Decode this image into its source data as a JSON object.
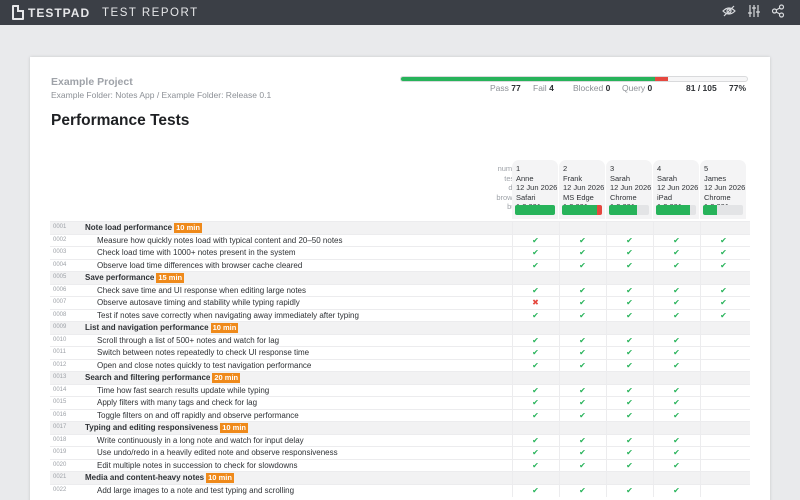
{
  "topbar": {
    "brand": "TESTPAD",
    "title": "TEST REPORT",
    "icons": [
      "eye-off-icon",
      "sliders-icon",
      "share-icon"
    ]
  },
  "report": {
    "project": "Example Project",
    "breadcrumb": "Example Folder: Notes App / Example Folder: Release 0.1",
    "title": "Performance Tests"
  },
  "summary": {
    "pass_label": "Pass",
    "pass": "77",
    "fail_label": "Fail",
    "fail": "4",
    "blocked_label": "Blocked",
    "blocked": "0",
    "query_label": "Query",
    "query": "0",
    "progress": "81 / 105",
    "percent": "77%",
    "bar": {
      "pass": 0.733,
      "fail": 0.038
    }
  },
  "header_labels": [
    "number",
    "tester",
    "date",
    "browser",
    "build"
  ],
  "columns": [
    {
      "number": "1",
      "tester": "Anne",
      "date": "12 Jun 2026",
      "browser": "Safari",
      "build": "1.2.001",
      "pass": 1.0,
      "fail": 0.0
    },
    {
      "number": "2",
      "tester": "Frank",
      "date": "12 Jun 2026",
      "browser": "MS Edge",
      "build": "1.2.001",
      "pass": 0.87,
      "fail": 0.13
    },
    {
      "number": "3",
      "tester": "Sarah",
      "date": "12 Jun 2026",
      "browser": "Chrome",
      "build": "1.2.001",
      "pass": 0.7,
      "fail": 0.0
    },
    {
      "number": "4",
      "tester": "Sarah",
      "date": "12 Jun 2026",
      "browser": "iPad",
      "build": "1.2.001",
      "pass": 0.85,
      "fail": 0.0
    },
    {
      "number": "5",
      "tester": "James",
      "date": "12 Jun 2026",
      "browser": "Chrome",
      "build": "1.2.001",
      "pass": 0.35,
      "fail": 0.0
    }
  ],
  "rows": [
    {
      "id": "0001",
      "kind": "section",
      "text": "Note load performance",
      "time": "10 min",
      "results": []
    },
    {
      "id": "0002",
      "kind": "test",
      "text": "Measure how quickly notes load with typical content and 20–50 notes",
      "results": [
        "p",
        "p",
        "p",
        "p",
        "p"
      ]
    },
    {
      "id": "0003",
      "kind": "test",
      "text": "Check load time with 1000+ notes present in the system",
      "results": [
        "p",
        "p",
        "p",
        "p",
        "p"
      ]
    },
    {
      "id": "0004",
      "kind": "test",
      "text": "Observe load time differences with browser cache cleared",
      "results": [
        "p",
        "p",
        "p",
        "p",
        "p"
      ]
    },
    {
      "id": "0005",
      "kind": "section",
      "text": "Save performance",
      "time": "15 min",
      "results": []
    },
    {
      "id": "0006",
      "kind": "test",
      "text": "Check save time and UI response when editing large notes",
      "results": [
        "p",
        "p",
        "p",
        "p",
        "p"
      ]
    },
    {
      "id": "0007",
      "kind": "test",
      "text": "Observe autosave timing and stability while typing rapidly",
      "results": [
        "f",
        "p",
        "p",
        "p",
        "p"
      ]
    },
    {
      "id": "0008",
      "kind": "test",
      "text": "Test if notes save correctly when navigating away immediately after typing",
      "results": [
        "p",
        "p",
        "p",
        "p",
        "p"
      ]
    },
    {
      "id": "0009",
      "kind": "section",
      "text": "List and navigation performance",
      "time": "10 min",
      "results": []
    },
    {
      "id": "0010",
      "kind": "test",
      "text": "Scroll through a list of 500+ notes and watch for lag",
      "results": [
        "p",
        "p",
        "p",
        "p",
        ""
      ]
    },
    {
      "id": "0011",
      "kind": "test",
      "text": "Switch between notes repeatedly to check UI response time",
      "results": [
        "p",
        "p",
        "p",
        "p",
        ""
      ]
    },
    {
      "id": "0012",
      "kind": "test",
      "text": "Open and close notes quickly to test navigation performance",
      "results": [
        "p",
        "p",
        "p",
        "p",
        ""
      ]
    },
    {
      "id": "0013",
      "kind": "section",
      "text": "Search and filtering performance",
      "time": "20 min",
      "results": []
    },
    {
      "id": "0014",
      "kind": "test",
      "text": "Time how fast search results update while typing",
      "results": [
        "p",
        "p",
        "p",
        "p",
        ""
      ]
    },
    {
      "id": "0015",
      "kind": "test",
      "text": "Apply filters with many tags and check for lag",
      "results": [
        "p",
        "p",
        "p",
        "p",
        ""
      ]
    },
    {
      "id": "0016",
      "kind": "test",
      "text": "Toggle filters on and off rapidly and observe performance",
      "results": [
        "p",
        "p",
        "p",
        "p",
        ""
      ]
    },
    {
      "id": "0017",
      "kind": "section",
      "text": "Typing and editing responsiveness",
      "time": "10 min",
      "results": []
    },
    {
      "id": "0018",
      "kind": "test",
      "text": "Write continuously in a long note and watch for input delay",
      "results": [
        "p",
        "p",
        "p",
        "p",
        ""
      ]
    },
    {
      "id": "0019",
      "kind": "test",
      "text": "Use undo/redo in a heavily edited note and observe responsiveness",
      "results": [
        "p",
        "p",
        "p",
        "p",
        ""
      ]
    },
    {
      "id": "0020",
      "kind": "test",
      "text": "Edit multiple notes in succession to check for slowdowns",
      "results": [
        "p",
        "p",
        "p",
        "p",
        ""
      ]
    },
    {
      "id": "0021",
      "kind": "section",
      "text": "Media and content-heavy notes",
      "time": "10 min",
      "results": []
    },
    {
      "id": "0022",
      "kind": "test",
      "text": "Add large images to a note and test typing and scrolling",
      "results": [
        "p",
        "p",
        "p",
        "p",
        ""
      ]
    }
  ],
  "colors": {
    "pass": "#27b35a",
    "fail": "#e5483f",
    "badge": "#ef8a1b",
    "topbar": "#3b3f46"
  }
}
